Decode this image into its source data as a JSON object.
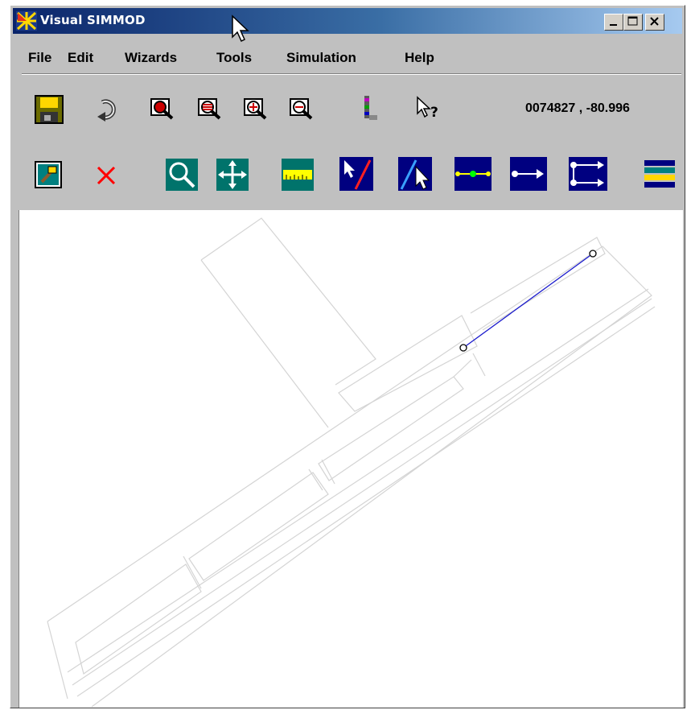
{
  "window": {
    "title": "Visual SIMMOD",
    "title_icon": "simmod-logo-icon"
  },
  "menu": [
    "File",
    "Edit",
    "Wizards",
    "Tools",
    "Simulation",
    "Help"
  ],
  "toolbar1": {
    "icons": [
      "save-icon",
      "refresh-icon",
      "zoom-in-icon",
      "zoom-out-icon",
      "zoom-extents-icon",
      "zoom-previous-icon",
      "legend-icon",
      "whats-this-icon"
    ],
    "coordinates": "0074827 , -80.996"
  },
  "toolbar2": {
    "icons": [
      "edit-properties-icon",
      "delete-icon",
      "zoom-tool-icon",
      "pan-tool-icon",
      "measure-tool-icon",
      "draw-link-icon",
      "select-link-icon",
      "add-node-icon",
      "add-link-icon",
      "add-route-icon",
      "layers-icon"
    ]
  },
  "colors": {
    "title_start": "#0a246a",
    "title_end": "#a6caf0",
    "selected_link": "#1a1acc",
    "toolbar_teal": "#00736b",
    "toolbar_navy": "#000080"
  }
}
